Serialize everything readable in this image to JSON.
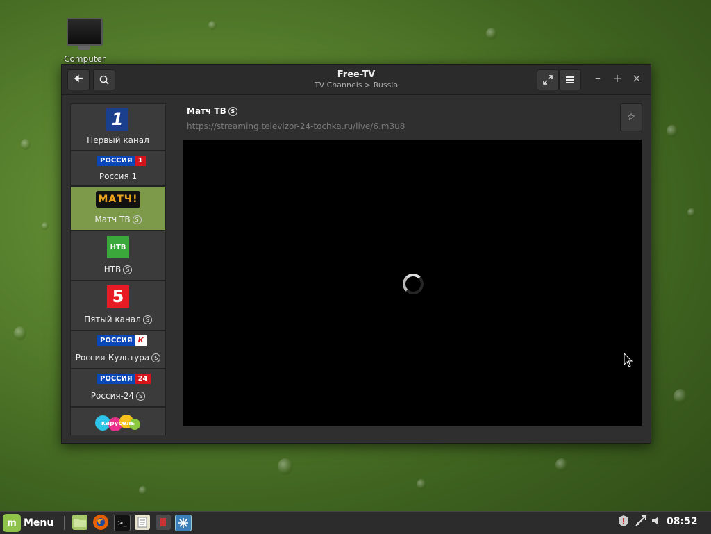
{
  "desktop": {
    "icon_label": "Computer"
  },
  "window": {
    "title": "Free-TV",
    "subtitle": "TV Channels > Russia",
    "controls": {
      "minimize": "–",
      "maximize": "+",
      "close": "×"
    }
  },
  "channels": [
    {
      "name": "Первый канал",
      "badge": ""
    },
    {
      "name": "Россия 1",
      "badge": ""
    },
    {
      "name": "Матч ТВ",
      "badge": "S",
      "active": true
    },
    {
      "name": "НТВ",
      "badge": "S"
    },
    {
      "name": "Пятый канал",
      "badge": "S"
    },
    {
      "name": "Россия-Культура",
      "badge": "S"
    },
    {
      "name": "Россия-24",
      "badge": "S"
    }
  ],
  "logos": {
    "rossia": "РОССИЯ",
    "rossia1_num": "1",
    "kultura_mark": "К",
    "r24_num": "24",
    "match": "МАТЧ!",
    "ntv": "НТВ",
    "five": "5",
    "karusel": "карусель"
  },
  "current": {
    "title": "Матч ТВ",
    "badge": "S",
    "url": "https://streaming.televizor-24-tochka.ru/live/6.m3u8"
  },
  "taskbar": {
    "menu_label": "Menu",
    "clock": "08:52",
    "terminal_glyph": ">_"
  },
  "colors": {
    "accent_active": "#7d9a4b",
    "window_bg": "#2f2f2f"
  }
}
